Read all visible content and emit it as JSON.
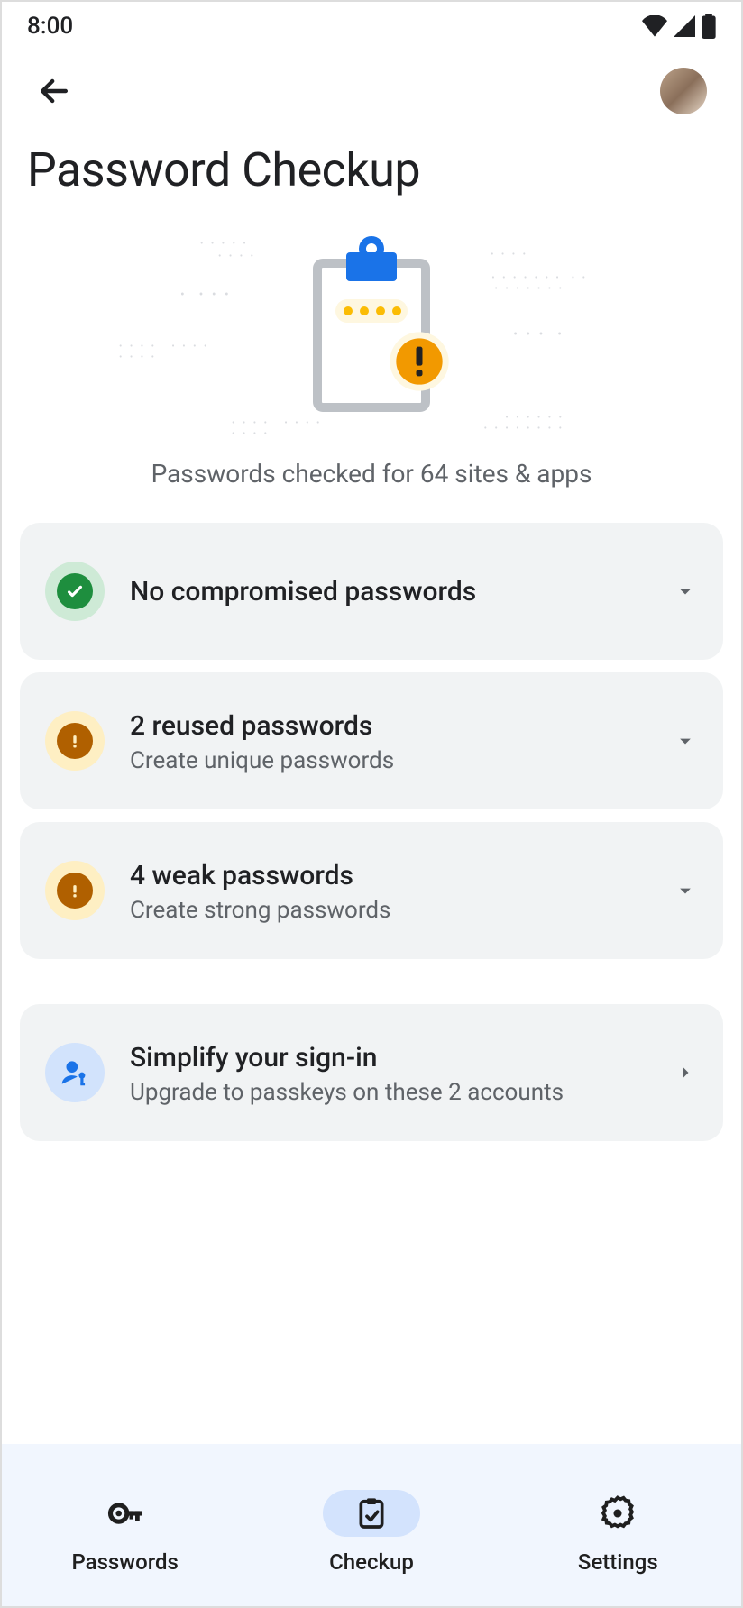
{
  "status_bar": {
    "time": "8:00"
  },
  "page": {
    "title": "Password Checkup",
    "subtitle": "Passwords checked for 64 sites & apps"
  },
  "cards": {
    "compromised": {
      "title": "No compromised passwords"
    },
    "reused": {
      "title": "2 reused passwords",
      "sub": "Create unique passwords"
    },
    "weak": {
      "title": "4 weak passwords",
      "sub": "Create strong passwords"
    },
    "passkeys": {
      "title": "Simplify your sign-in",
      "sub": "Upgrade to passkeys on these 2 accounts"
    }
  },
  "nav": {
    "passwords": "Passwords",
    "checkup": "Checkup",
    "settings": "Settings"
  }
}
